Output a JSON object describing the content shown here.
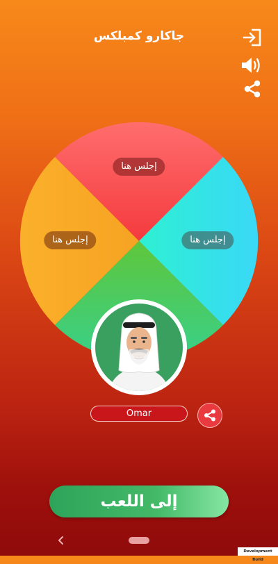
{
  "header": {
    "title": "جاكارو كمبلكس",
    "icons": [
      "exit-icon",
      "speaker-icon",
      "share-icon"
    ]
  },
  "table": {
    "seats": [
      {
        "position": "top",
        "label": "إجلس هنا",
        "color": "#fb4f55"
      },
      {
        "position": "left",
        "label": "إجلس هنا",
        "color": "#f9a722"
      },
      {
        "position": "right",
        "label": "إجلس هنا",
        "color": "#2ee8e2"
      },
      {
        "position": "bottom",
        "color": "#4cc450"
      }
    ]
  },
  "player": {
    "name": "Omar",
    "avatar": "avatar-man-ghutra"
  },
  "play_button": {
    "label": "إلى اللعب"
  },
  "system": {
    "dev_build_label": "Development Build"
  }
}
